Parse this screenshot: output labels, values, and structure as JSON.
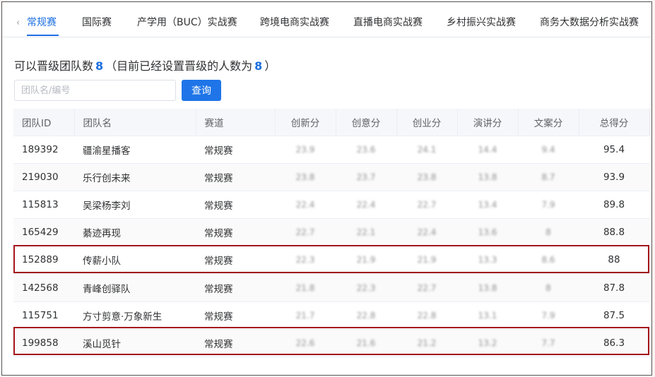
{
  "tabs": [
    {
      "label": "常规赛"
    },
    {
      "label": "国际赛"
    },
    {
      "label": "产学用（BUC）实战赛"
    },
    {
      "label": "跨境电商实战赛"
    },
    {
      "label": "直播电商实战赛"
    },
    {
      "label": "乡村振兴实战赛"
    },
    {
      "label": "商务大数据分析实战赛"
    }
  ],
  "promotion": {
    "prefix": "可以晋级团队数",
    "count": "8",
    "middle": "（目前已经设置晋级的人数为",
    "set_count": "8",
    "suffix": "）"
  },
  "search": {
    "placeholder": "团队名/编号",
    "button_label": "查询"
  },
  "table": {
    "headers": [
      "团队ID",
      "团队名",
      "赛道",
      "创新分",
      "创意分",
      "创业分",
      "演讲分",
      "文案分",
      "总得分"
    ],
    "rows": [
      {
        "id": "189392",
        "name": "疆渝星播客",
        "track": "常规赛",
        "innovation": "23.9",
        "creativity": "23.6",
        "business": "24.1",
        "speech": "14.4",
        "copy": "9.4",
        "total": "95.4"
      },
      {
        "id": "219030",
        "name": "乐行创未来",
        "track": "常规赛",
        "innovation": "23.8",
        "creativity": "23.7",
        "business": "23.8",
        "speech": "13.8",
        "copy": "8.7",
        "total": "93.9"
      },
      {
        "id": "115813",
        "name": "吴梁杨李刘",
        "track": "常规赛",
        "innovation": "22.4",
        "creativity": "22.4",
        "business": "22.7",
        "speech": "13.4",
        "copy": "7.9",
        "total": "89.8"
      },
      {
        "id": "165429",
        "name": "綦迹再现",
        "track": "常规赛",
        "innovation": "22.7",
        "creativity": "22.1",
        "business": "22.4",
        "speech": "13.6",
        "copy": "8",
        "total": "88.8"
      },
      {
        "id": "152889",
        "name": "传薪小队",
        "track": "常规赛",
        "innovation": "22.3",
        "creativity": "21.9",
        "business": "21.9",
        "speech": "13.3",
        "copy": "8.6",
        "total": "88"
      },
      {
        "id": "142568",
        "name": "青峰创驿队",
        "track": "常规赛",
        "innovation": "21.8",
        "creativity": "22.3",
        "business": "22.7",
        "speech": "13.8",
        "copy": "8",
        "total": "87.8"
      },
      {
        "id": "115751",
        "name": "方寸剪意·万象新生",
        "track": "常规赛",
        "innovation": "21.7",
        "creativity": "22.8",
        "business": "22.8",
        "speech": "13.1",
        "copy": "7.9",
        "total": "87.5"
      },
      {
        "id": "199858",
        "name": "溪山觅针",
        "track": "常规赛",
        "innovation": "22.6",
        "creativity": "21.6",
        "business": "21.2",
        "speech": "13.2",
        "copy": "7.7",
        "total": "86.3"
      }
    ]
  },
  "colors": {
    "accent": "#1d6fe0",
    "highlight_box": "#a3161c"
  }
}
